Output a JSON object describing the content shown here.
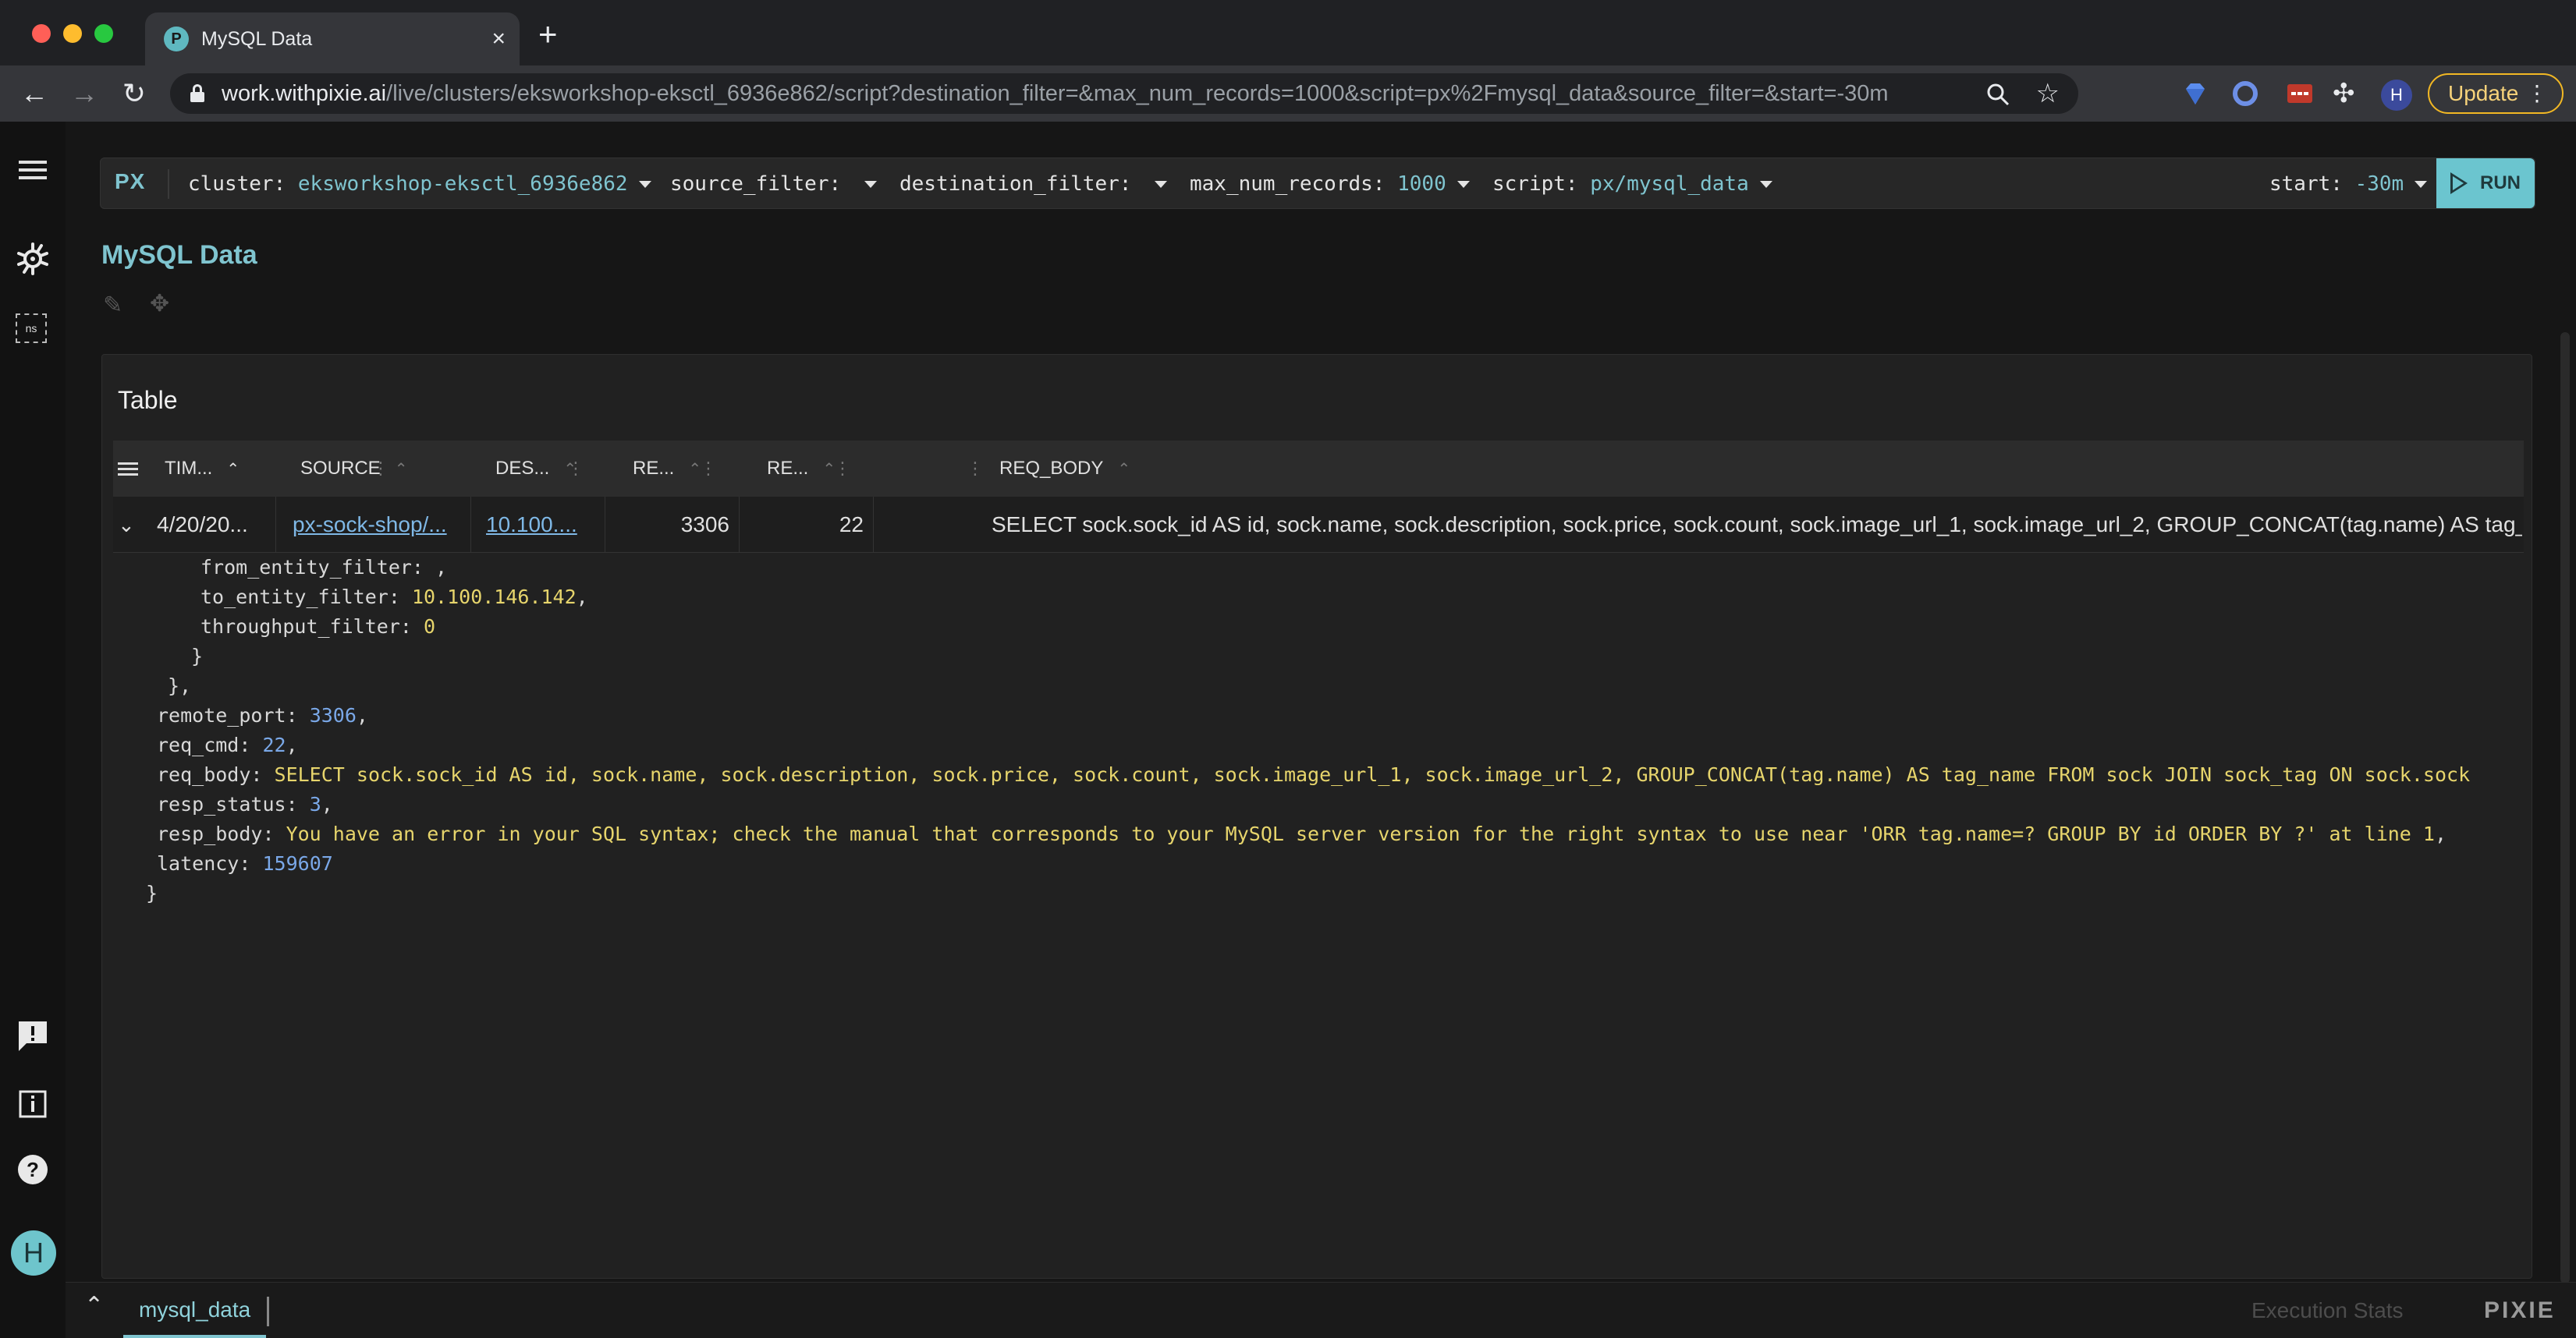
{
  "browser": {
    "tab_title": "MySQL Data",
    "tab_favicon": "pixie-favicon",
    "url_host": "work.withpixie.ai",
    "url_path": "/live/clusters/eksworkshop-eksctl_6936e862/script?destination_filter=&max_num_records=1000&script=px%2Fmysql_data&source_filter=&start=-30m",
    "update_label": "Update",
    "profile_initial": "H"
  },
  "script_bar": {
    "logo": "PX",
    "args": [
      {
        "key": "cluster:",
        "value": "eksworkshop-eksctl_6936e862"
      },
      {
        "key": "source_filter:",
        "value": ""
      },
      {
        "key": "destination_filter:",
        "value": ""
      },
      {
        "key": "max_num_records:",
        "value": "1000"
      },
      {
        "key": "script:",
        "value": "px/mysql_data"
      },
      {
        "key": "start:",
        "value": "-30m"
      }
    ],
    "run_label": "RUN"
  },
  "page": {
    "title": "MySQL Data"
  },
  "table": {
    "title": "Table",
    "columns": [
      "TIM...",
      "SOURCE",
      "DES...",
      "RE...",
      "RE...",
      "REQ_BODY"
    ],
    "row": {
      "time": "4/20/20...",
      "source": "px-sock-shop/...",
      "destination": "10.100....",
      "remote_port": "3306",
      "req_cmd": "22",
      "req_body": "SELECT sock.sock_id AS id, sock.name, sock.description, sock.price, sock.count, sock.image_url_1, sock.image_url_2, GROUP_CONCAT(tag.name) AS tag_name FRO"
    },
    "json": {
      "from_entity_filter_key": "from_entity_filter:",
      "from_entity_filter_val": ",",
      "to_entity_filter_key": "to_entity_filter:",
      "to_entity_filter_val": "10.100.146.142",
      "throughput_filter_key": "throughput_filter:",
      "throughput_filter_val": "0",
      "remote_port_key": "remote_port:",
      "remote_port_val": "3306",
      "req_cmd_key": "req_cmd:",
      "req_cmd_val": "22",
      "req_body_key": "req_body:",
      "req_body_val": "SELECT sock.sock_id AS id, sock.name, sock.description, sock.price, sock.count, sock.image_url_1, sock.image_url_2, GROUP_CONCAT(tag.name) AS tag_name FROM sock JOIN sock_tag ON sock.sock",
      "resp_status_key": "resp_status:",
      "resp_status_val": "3",
      "resp_body_key": "resp_body:",
      "resp_body_val": "You have an error in your SQL syntax; check the manual that corresponds to your MySQL server version for the right syntax to use near 'ORR tag.name=? GROUP BY id ORDER BY ?' at line 1",
      "latency_key": "latency:",
      "latency_val": "159607"
    }
  },
  "bottom": {
    "script_tab": "mysql_data",
    "exec_stats": "Execution Stats",
    "brand": "PIXIE"
  },
  "rail": {
    "ns_label": "ns",
    "user_initial": "H"
  },
  "colors": {
    "accent": "#7fc4cf",
    "number": "#7aa8e8",
    "string": "#e7d56c",
    "link": "#7fb8e6"
  }
}
